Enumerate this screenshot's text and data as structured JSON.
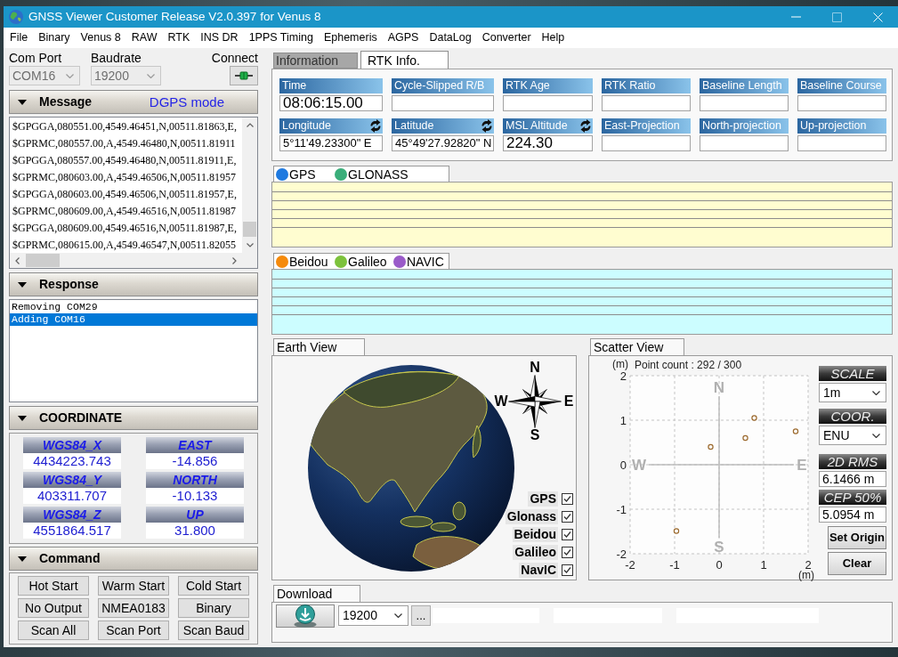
{
  "window": {
    "title": "GNSS Viewer Customer Release V2.0.397 for Venus 8",
    "maximize_disabled": true
  },
  "menu": [
    "File",
    "Binary",
    "Venus 8",
    "RAW",
    "RTK",
    "INS DR",
    "1PPS Timing",
    "Ephemeris",
    "AGPS",
    "DataLog",
    "Converter",
    "Help"
  ],
  "connection": {
    "com_port": {
      "label": "Com Port",
      "value": "COM16",
      "disabled": true
    },
    "baudrate": {
      "label": "Baudrate",
      "value": "19200",
      "disabled": true
    },
    "connect": {
      "label": "Connect"
    }
  },
  "message": {
    "title": "Message",
    "expanded": true,
    "mode": "DGPS mode",
    "lines": [
      "$GPGGA,080551.00,4549.46451,N,00511.81863,E,",
      "$GPRMC,080557.00,A,4549.46480,N,00511.81911",
      "$GPGGA,080557.00,4549.46480,N,00511.81911,E,",
      "$GPRMC,080603.00,A,4549.46506,N,00511.81957",
      "$GPGGA,080603.00,4549.46506,N,00511.81957,E,",
      "$GPRMC,080609.00,A,4549.46516,N,00511.81987",
      "$GPGGA,080609.00,4549.46516,N,00511.81987,E,",
      "$GPRMC,080615.00,A,4549.46547,N,00511.82055"
    ]
  },
  "response": {
    "title": "Response",
    "expanded": true,
    "lines": [
      {
        "text": "Removing COM29",
        "selected": false
      },
      {
        "text": "Adding COM16",
        "selected": true
      }
    ]
  },
  "coordinate": {
    "title": "COORDINATE",
    "expanded": true,
    "cells": [
      {
        "label": "WGS84_X",
        "value": "4434223.743"
      },
      {
        "label": "EAST",
        "value": "-14.856"
      },
      {
        "label": "WGS84_Y",
        "value": "403311.707"
      },
      {
        "label": "NORTH",
        "value": "-10.133"
      },
      {
        "label": "WGS84_Z",
        "value": "4551864.517"
      },
      {
        "label": "UP",
        "value": "31.800"
      }
    ]
  },
  "command": {
    "title": "Command",
    "expanded": true,
    "buttons": [
      "Hot Start",
      "Warm Start",
      "Cold Start",
      "No Output",
      "NMEA0183",
      "Binary",
      "Scan All",
      "Scan Port",
      "Scan Baud"
    ]
  },
  "tabs": [
    {
      "label": "Information",
      "selected": false
    },
    {
      "label": "RTK Info.",
      "selected": true
    }
  ],
  "rtk_fields": [
    {
      "label": "Time",
      "kind": "plain",
      "value": "08:06:15.00"
    },
    {
      "label": "Cycle-Slipped R/B",
      "kind": "plain"
    },
    {
      "label": "RTK Age",
      "kind": "plain"
    },
    {
      "label": "RTK Ratio",
      "kind": "plain"
    },
    {
      "label": "Baseline Length",
      "kind": "plain"
    },
    {
      "label": "Baseline Course",
      "kind": "plain"
    },
    {
      "label": "Longitude",
      "kind": "convertible",
      "value": "5°11'49.23300\" E"
    },
    {
      "label": "Latitude",
      "kind": "convertible",
      "value": "45°49'27.92820\" N"
    },
    {
      "label": "MSL Altitude",
      "kind": "convertible",
      "value": "224.30"
    },
    {
      "label": "East-Projection",
      "kind": "plain"
    },
    {
      "label": "North-projection",
      "kind": "plain"
    },
    {
      "label": "Up-projection",
      "kind": "plain"
    }
  ],
  "signal_panels": [
    {
      "color": "#fffdd0",
      "legend": [
        {
          "name": "GPS",
          "color": "#1f7ae0"
        },
        {
          "name": "GLONASS",
          "color": "#3aae7a"
        }
      ]
    },
    {
      "color": "#ccfdff",
      "legend": [
        {
          "name": "Beidou",
          "color": "#f58a0b"
        },
        {
          "name": "Galileo",
          "color": "#7dc23c"
        },
        {
          "name": "NAVIC",
          "color": "#9a5bc9"
        }
      ]
    }
  ],
  "earth_view": {
    "title": "Earth View",
    "compass": {
      "north": "N",
      "east": "E",
      "south": "S",
      "west": "W"
    },
    "constellations": [
      {
        "label": "GPS",
        "checked": true
      },
      {
        "label": "Glonass",
        "checked": true
      },
      {
        "label": "Beidou",
        "checked": true
      },
      {
        "label": "Galileo",
        "checked": true
      },
      {
        "label": "NavIC",
        "checked": true
      }
    ]
  },
  "scatter_view": {
    "title": "Scatter View",
    "point_count": "Point count : 292 / 300",
    "direction_labels": {
      "north": "N",
      "south": "S",
      "west": "W",
      "east": "E"
    },
    "chart_data": {
      "type": "scatter",
      "xlabel": "(m)",
      "ylabel": "(m)",
      "xlim": [
        -2,
        2
      ],
      "ylim": [
        -2,
        2
      ],
      "xticks": [
        -2,
        -1,
        0,
        1,
        2
      ],
      "yticks": [
        -2,
        -1,
        0,
        1,
        2
      ],
      "grid": true,
      "x": [
        -0.96,
        -0.19,
        0.59,
        0.79,
        1.72
      ],
      "series": [
        {
          "color": "#9c6a2e",
          "values": [
            -1.49,
            0.4,
            0.6,
            1.05,
            0.75
          ]
        }
      ]
    },
    "scale": {
      "label": "SCALE",
      "value": "1m"
    },
    "coordinate_system": {
      "label": "COOR.",
      "value": "ENU"
    },
    "rms_2d": {
      "label": "2D RMS",
      "value": "6.1466 m"
    },
    "cep_50": {
      "label": "CEP 50%",
      "value": "5.0954 m"
    },
    "buttons": [
      "Set Origin",
      "Clear"
    ]
  },
  "download": {
    "title": "Download",
    "baudrate": "19200",
    "browse": "..."
  }
}
